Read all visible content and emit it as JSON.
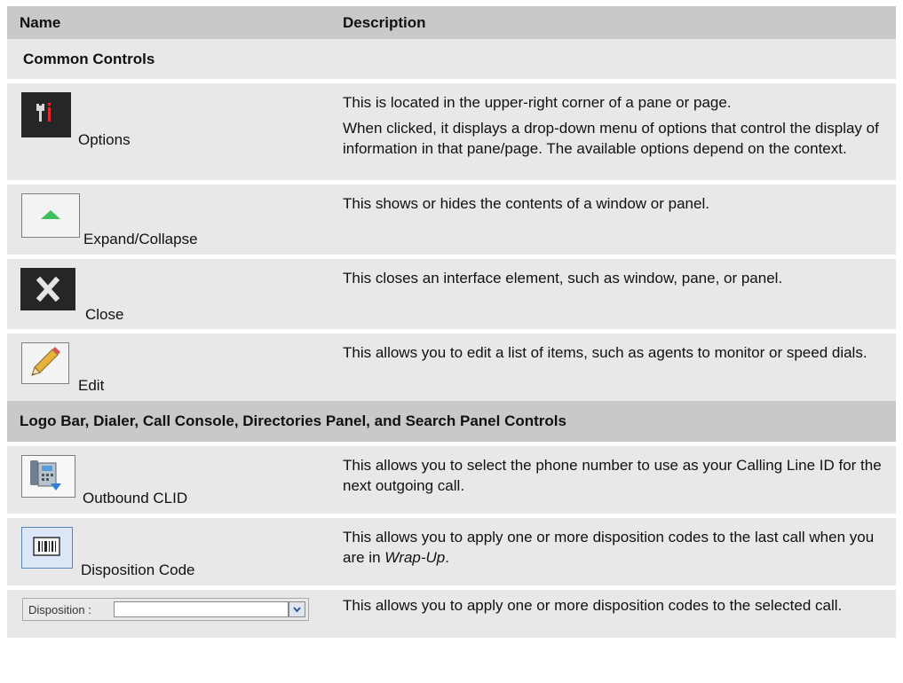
{
  "table": {
    "headers": {
      "name": "Name",
      "description": "Description"
    },
    "sections": [
      {
        "title": "Common Controls",
        "rows": [
          {
            "name": "Options",
            "icon": "options-icon",
            "description": [
              "This is located in the upper-right corner of a pane or page.",
              "When clicked, it displays a drop-down menu of options that control the display of information in that pane/page.  The available options depend on the context."
            ]
          },
          {
            "name": "Expand/Collapse",
            "icon": "expand-collapse-icon",
            "description": [
              "This shows or hides the contents of a window or panel."
            ]
          },
          {
            "name": "Close",
            "icon": "close-icon",
            "description": [
              "This closes an interface element, such as window, pane, or panel."
            ]
          },
          {
            "name": "Edit",
            "icon": "pencil-icon",
            "description": [
              "This allows you to edit a list of items, such as agents to monitor or speed dials."
            ]
          }
        ]
      },
      {
        "title": "Logo Bar, Dialer, Call Console, Directories Panel, and Search Panel Controls",
        "rows": [
          {
            "name": "Outbound CLID",
            "icon": "phone-dropdown-icon",
            "description": [
              "This allows you to select the phone number to use as your Calling Line ID for the next outgoing call."
            ]
          },
          {
            "name": "Disposition Code",
            "icon": "barcode-icon",
            "description_pre": "This allows you to apply one or more disposition codes to the last call when you are in ",
            "description_em": "Wrap-Up",
            "description_post": "."
          },
          {
            "name": "",
            "icon": "disposition-dropdown",
            "control": {
              "label": "Disposition :",
              "value": ""
            },
            "description": [
              "This allows you to apply one or more disposition codes to the selected call."
            ]
          }
        ]
      }
    ]
  },
  "colors": {
    "header_bg": "#c9c9c9",
    "row_bg": "#e8e8e8",
    "icon_dark": "#262626",
    "icon_red": "#e0282e",
    "arrow_green": "#3fbf5a"
  }
}
